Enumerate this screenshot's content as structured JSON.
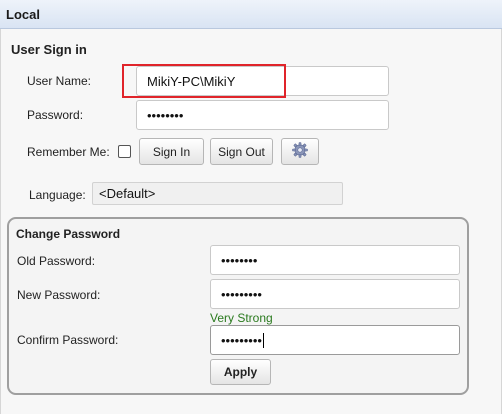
{
  "header": {
    "title": "Local"
  },
  "sign_in": {
    "title": "User Sign in",
    "username_label": "User Name:",
    "username_value": "MikiY-PC\\MikiY",
    "password_label": "Password:",
    "password_value": "••••••••",
    "remember_label": "Remember Me:",
    "remember_checked": false,
    "sign_in_label": "Sign In",
    "sign_out_label": "Sign Out",
    "settings_icon": "gear-icon"
  },
  "language": {
    "label": "Language:",
    "selected": "<Default>"
  },
  "change_password": {
    "title": "Change Password",
    "old_label": "Old Password:",
    "old_value": "••••••••",
    "new_label": "New Password:",
    "new_value": "•••••••••",
    "strength": "Very Strong",
    "strength_color": "#2a7a1e",
    "confirm_label": "Confirm Password:",
    "confirm_value": "•••••••••",
    "apply_label": "Apply"
  },
  "colors": {
    "highlight": "#e0242a",
    "header_bg": "#dce6f4"
  }
}
